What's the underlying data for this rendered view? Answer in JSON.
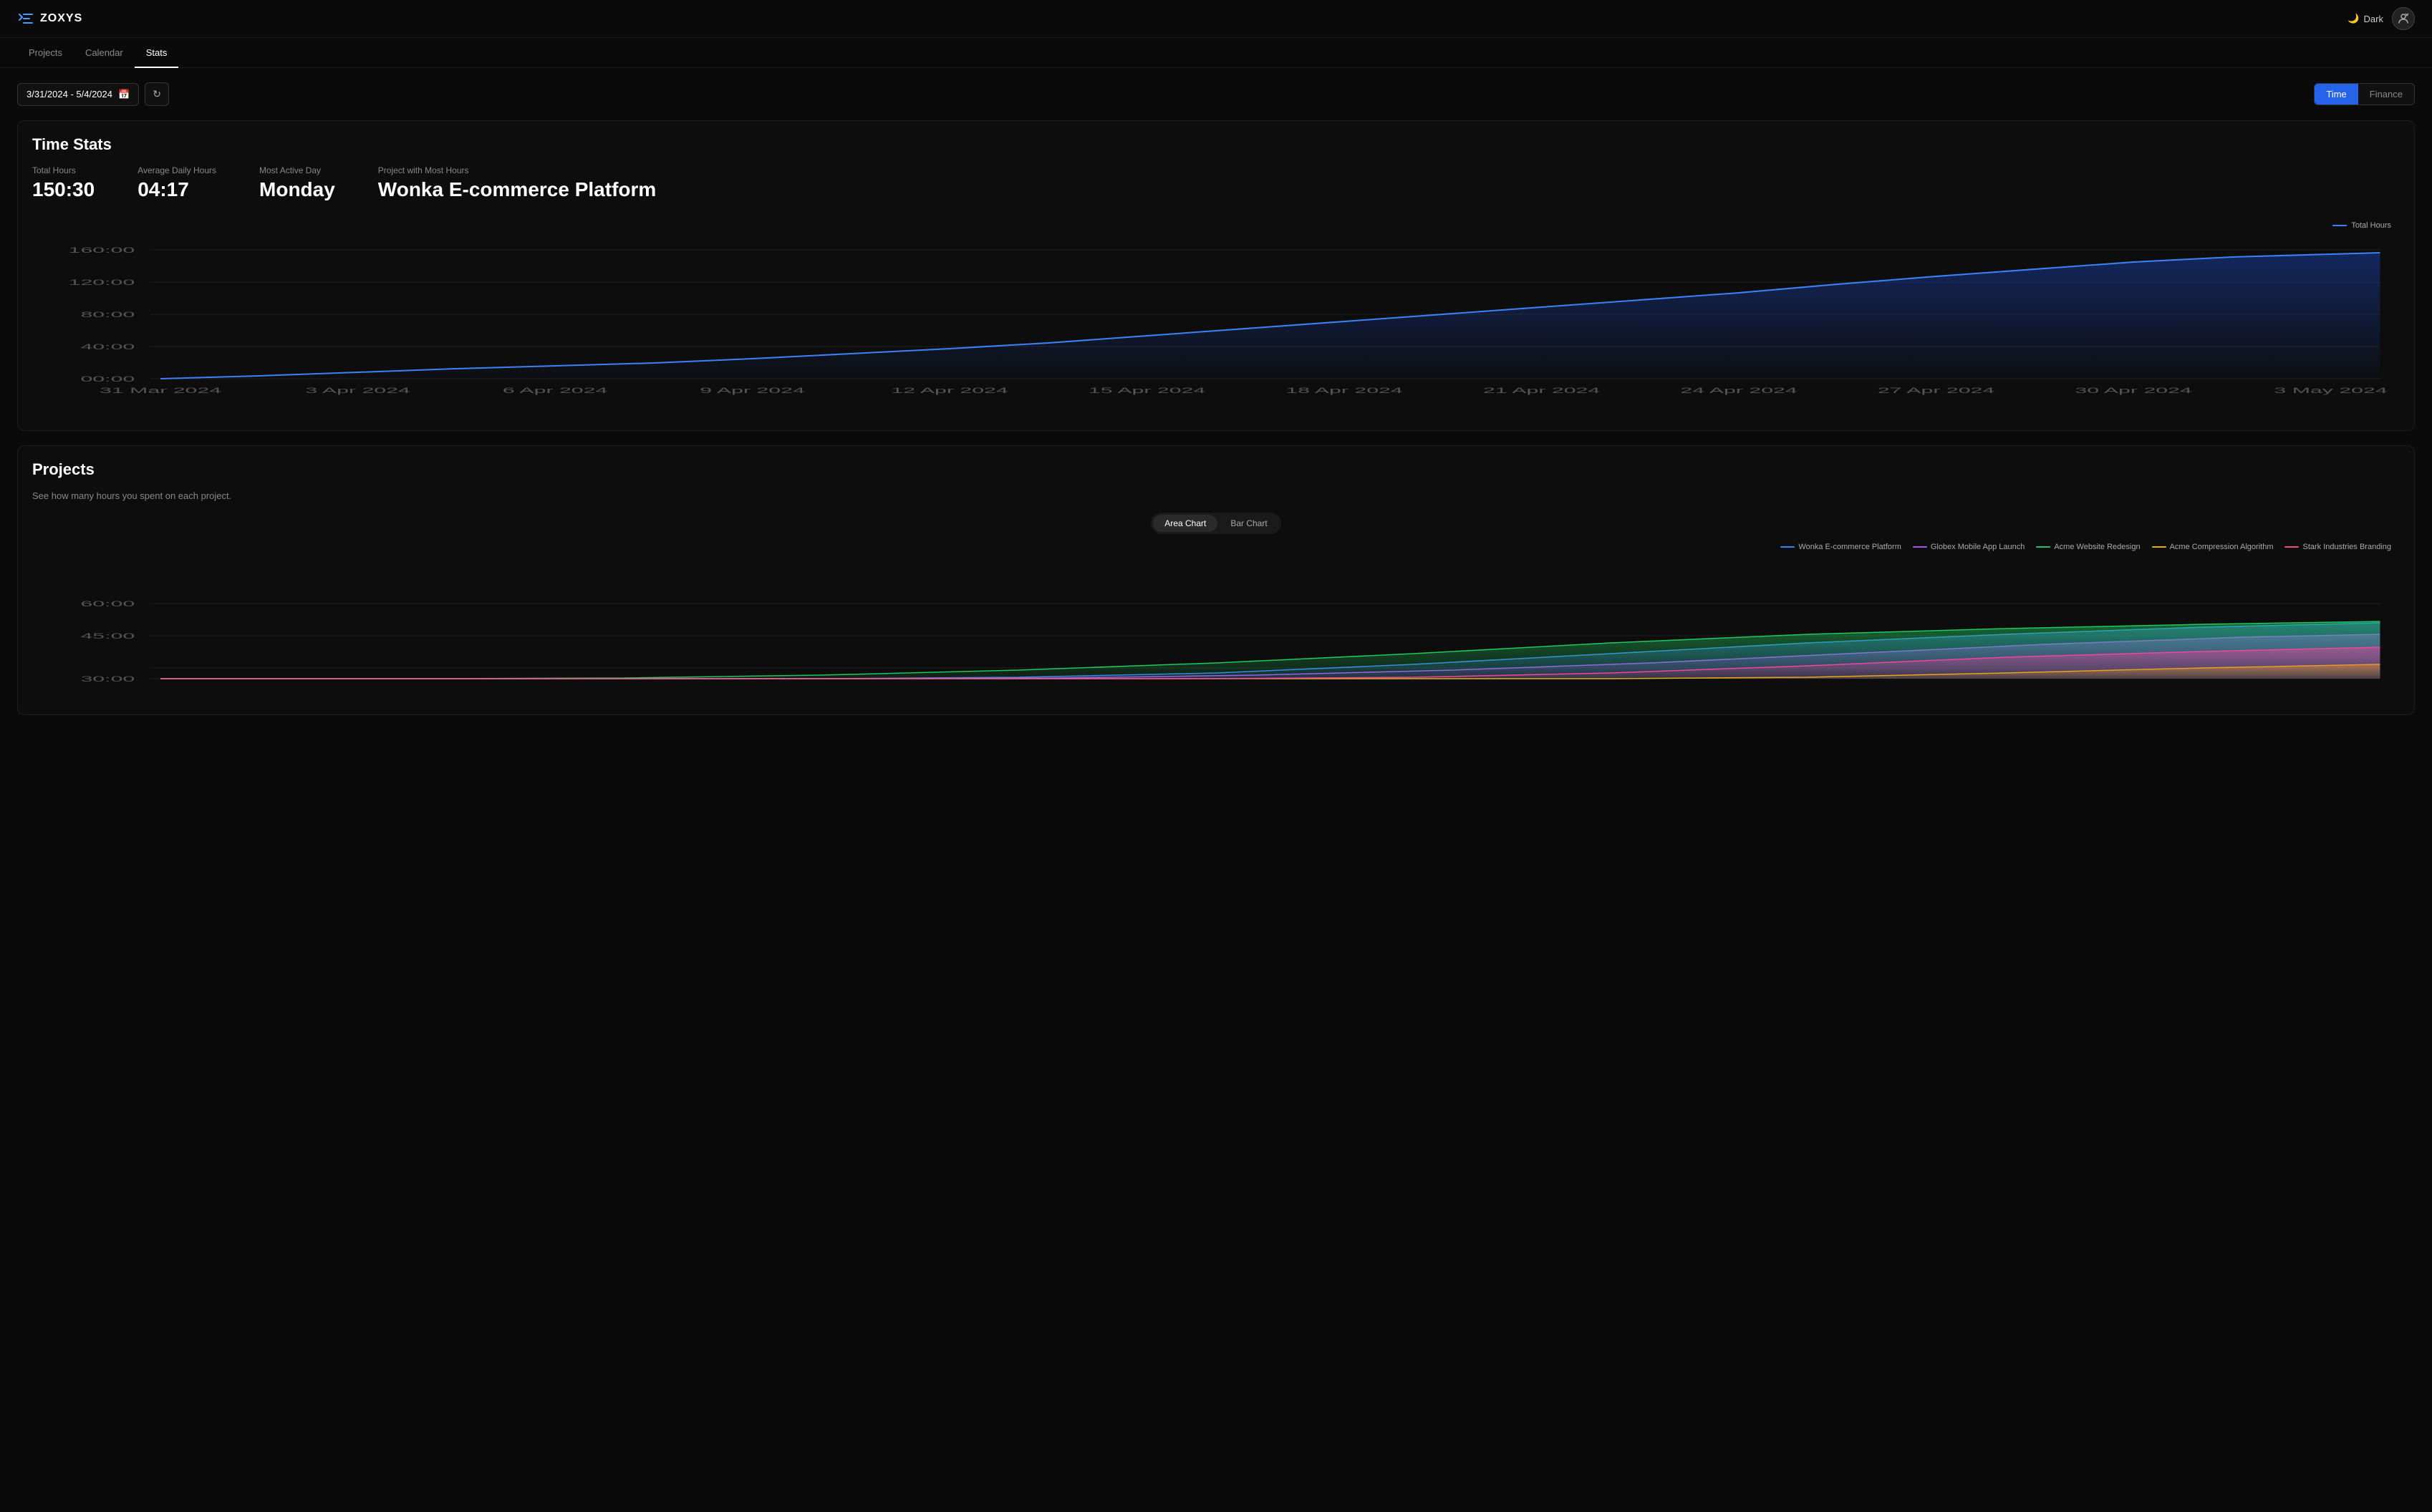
{
  "app": {
    "logo_text": "ZOXYS",
    "theme_label": "Dark",
    "nav_items": [
      {
        "id": "projects",
        "label": "Projects",
        "active": false
      },
      {
        "id": "calendar",
        "label": "Calendar",
        "active": false
      },
      {
        "id": "stats",
        "label": "Stats",
        "active": true
      }
    ]
  },
  "toolbar": {
    "date_range": "3/31/2024 - 5/4/2024",
    "view_buttons": [
      {
        "id": "time",
        "label": "Time",
        "active": true
      },
      {
        "id": "finance",
        "label": "Finance",
        "active": false
      }
    ]
  },
  "time_stats": {
    "section_title": "Time Stats",
    "stats": [
      {
        "id": "total_hours",
        "label": "Total Hours",
        "value": "150:30"
      },
      {
        "id": "avg_daily",
        "label": "Average Daily Hours",
        "value": "04:17"
      },
      {
        "id": "most_active_day",
        "label": "Most Active Day",
        "value": "Monday"
      },
      {
        "id": "project_most",
        "label": "Project with Most Hours",
        "value": "Wonka E-commerce Platform"
      }
    ],
    "chart_legend": "Total Hours",
    "x_labels": [
      "31 Mar 2024",
      "3 Apr 2024",
      "6 Apr 2024",
      "9 Apr 2024",
      "12 Apr 2024",
      "15 Apr 2024",
      "18 Apr 2024",
      "21 Apr 2024",
      "24 Apr 2024",
      "27 Apr 2024",
      "30 Apr 2024",
      "3 May 2024"
    ],
    "y_labels": [
      "00:00",
      "40:00",
      "80:00",
      "120:00",
      "160:00"
    ]
  },
  "projects": {
    "section_title": "Projects",
    "subtitle": "See how many hours you spent on each project.",
    "chart_types": [
      {
        "id": "area",
        "label": "Area Chart",
        "active": true
      },
      {
        "id": "bar",
        "label": "Bar Chart",
        "active": false
      }
    ],
    "legend": [
      {
        "id": "wonka",
        "label": "Wonka E-commerce Platform",
        "color": "#3b82f6"
      },
      {
        "id": "globex",
        "label": "Globex Mobile App Launch",
        "color": "#a855f7"
      },
      {
        "id": "acme_web",
        "label": "Acme Website Redesign",
        "color": "#22c55e"
      },
      {
        "id": "acme_comp",
        "label": "Acme Compression Algorithm",
        "color": "#eab308"
      },
      {
        "id": "stark",
        "label": "Stark Industries Branding",
        "color": "#ec4899"
      }
    ],
    "y_labels": [
      "30:00",
      "45:00",
      "60:00"
    ]
  }
}
